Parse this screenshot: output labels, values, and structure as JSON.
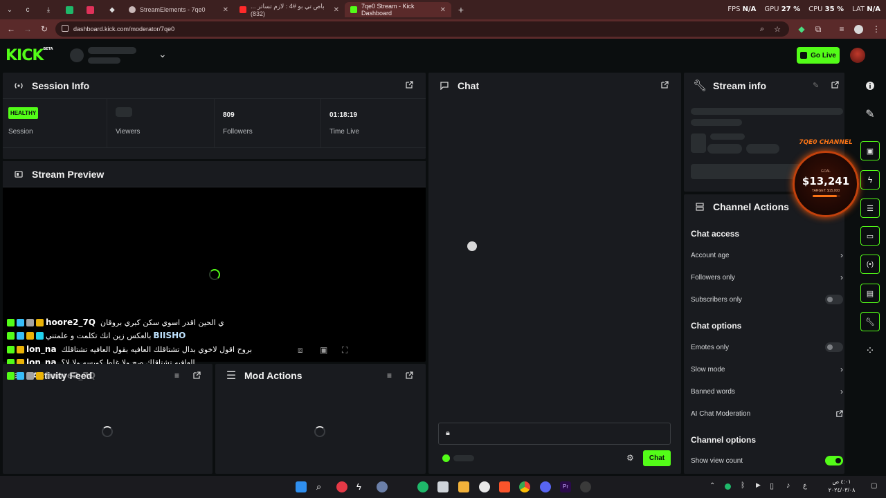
{
  "browser": {
    "tabs": [
      {
        "title": "StreamElements - 7qe0",
        "active": false
      },
      {
        "title": "باص تي بو #4 : لازم تساتر ... (832)",
        "active": false
      },
      {
        "title": "7qe0 Stream - Kick Dashboard",
        "active": true
      }
    ],
    "new_tab": "+",
    "url": "dashboard.kick.com/moderator/7qe0",
    "perf": {
      "fps_label": "FPS",
      "fps_value": "N/A",
      "gpu_label": "GPU",
      "gpu_value": "27 %",
      "cpu_label": "CPU",
      "cpu_value": "35 %",
      "lat_label": "LAT",
      "lat_value": "N/A"
    }
  },
  "header": {
    "logo": "KICK",
    "logo_badge": "BETA",
    "go_live": "Go Live"
  },
  "session": {
    "title": "Session Info",
    "health_badge": "HEALTHY",
    "health_label": "Session",
    "viewers_label": "Viewers",
    "followers_value": "809",
    "followers_label": "Followers",
    "time_value": "01:18:19",
    "time_label": "Time Live"
  },
  "preview": {
    "title": "Stream Preview",
    "overlay_chat": [
      {
        "user": "hoore2_7Q",
        "text": "ي الحين اقدر اسوي سكن كبري بروقان"
      },
      {
        "user": "BIISHO",
        "text": "بالعكس زين انك تكلمت و علمتني"
      },
      {
        "user": "lon_na",
        "text": "بروح اقول لاخوي بدال تشتاقلك العافيه بقول العافيه تشتاقلك"
      },
      {
        "user": "lon_na",
        "text": "العافيه تشتاقلك صح ولا غلط كويسه ولا لا؟"
      },
      {
        "user": "hoore2_7Q",
        "text": ""
      }
    ]
  },
  "activity": {
    "title": "Activity Feed"
  },
  "mod_actions": {
    "title": "Mod Actions"
  },
  "chat": {
    "title": "Chat",
    "send": "Chat"
  },
  "stream_info": {
    "title": "Stream info"
  },
  "goal": {
    "channel": "7QE0 CHANNEL",
    "label": "GOAL",
    "amount": "$13,241",
    "target": "TARGET: $15,000",
    "progress": 0.88
  },
  "channel_actions": {
    "title": "Channel Actions",
    "chat_access_title": "Chat access",
    "account_age": "Account age",
    "followers_only": "Followers only",
    "subscribers_only": "Subscribers only",
    "chat_options_title": "Chat options",
    "emotes_only": "Emotes only",
    "slow_mode": "Slow mode",
    "banned_words": "Banned words",
    "ai_moderation": "AI Chat Moderation",
    "channel_options_title": "Channel options",
    "show_view_count": "Show view count"
  },
  "taskbar": {
    "date": "٢٠٢٤/٠٣/٠٨",
    "time": "٤:٠١ ص",
    "lang": "ع"
  },
  "colors": {
    "accent": "#53fc18",
    "panel": "#191b1f",
    "bg": "#0b0e0f",
    "tabstrip": "#3c2020"
  }
}
